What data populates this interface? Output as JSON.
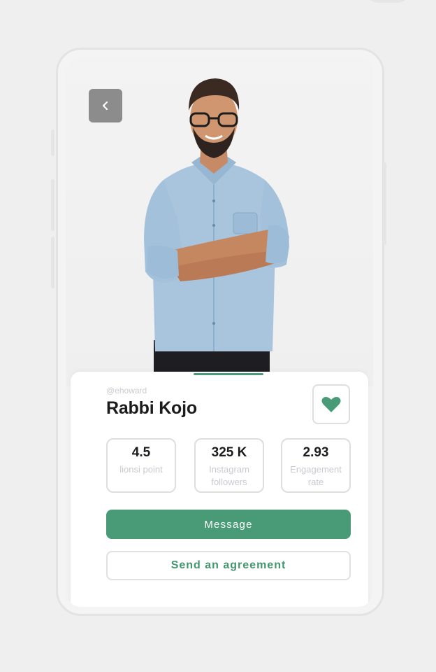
{
  "profile": {
    "handle": "@ehoward",
    "name": "Rabbi Kojo"
  },
  "stats": [
    {
      "value": "4.5",
      "label_line1": "lionsi point",
      "label_line2": ""
    },
    {
      "value": "325 K",
      "label_line1": "Instagram",
      "label_line2": "followers"
    },
    {
      "value": "2.93",
      "label_line1": "Engagement",
      "label_line2": "rate"
    }
  ],
  "actions": {
    "message_label": "Message",
    "agreement_label": "Send an agreement"
  },
  "icons": {
    "back": "chevron-left-icon",
    "favorite": "heart-icon"
  },
  "colors": {
    "accent": "#489b76",
    "accent_text": "#43966f",
    "back_button": "#8c8c8c",
    "muted_text": "#c8cbd0"
  }
}
